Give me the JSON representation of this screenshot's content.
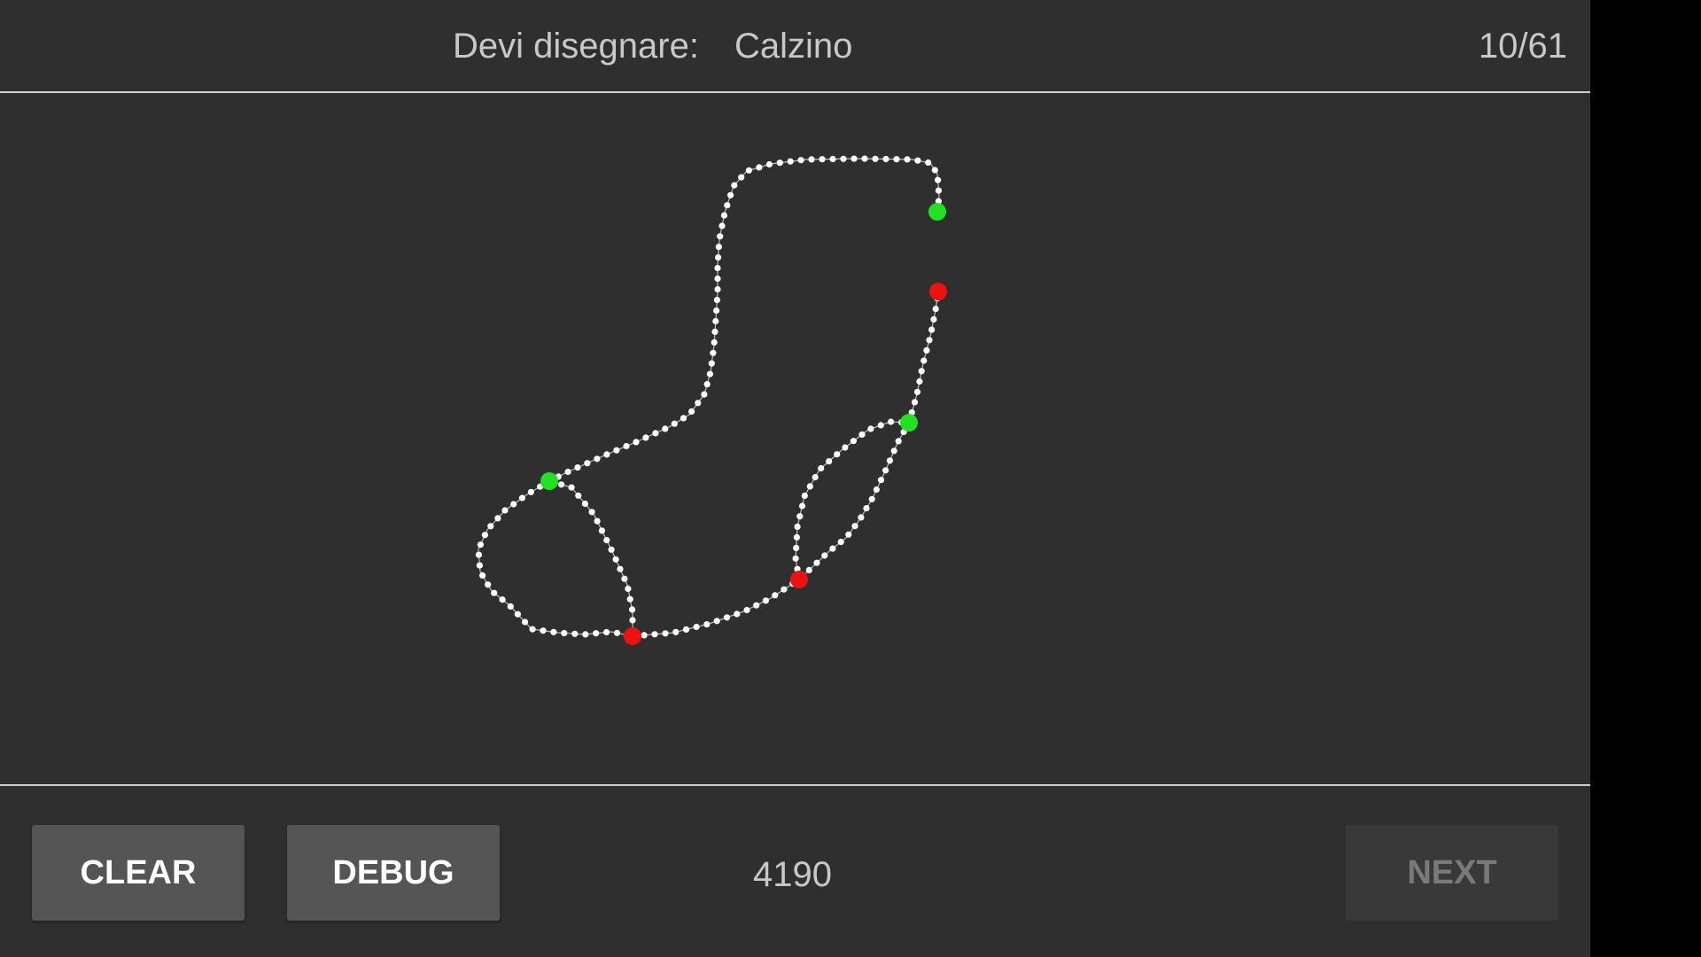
{
  "header": {
    "prompt_label": "Devi disegnare:",
    "prompt_word": "Calzino",
    "progress": "10/61"
  },
  "footer": {
    "clear_label": "CLEAR",
    "debug_label": "DEBUG",
    "score": "4190",
    "next_label": "NEXT"
  },
  "colors": {
    "background": "#2f2f2f",
    "stroke_point": "#ffffff",
    "start_marker": "#22e022",
    "end_marker": "#ee1111",
    "button": "#555555",
    "button_disabled": "#393939"
  },
  "drawing": {
    "description_icon": "sock-drawing",
    "stroke_count": 4
  }
}
